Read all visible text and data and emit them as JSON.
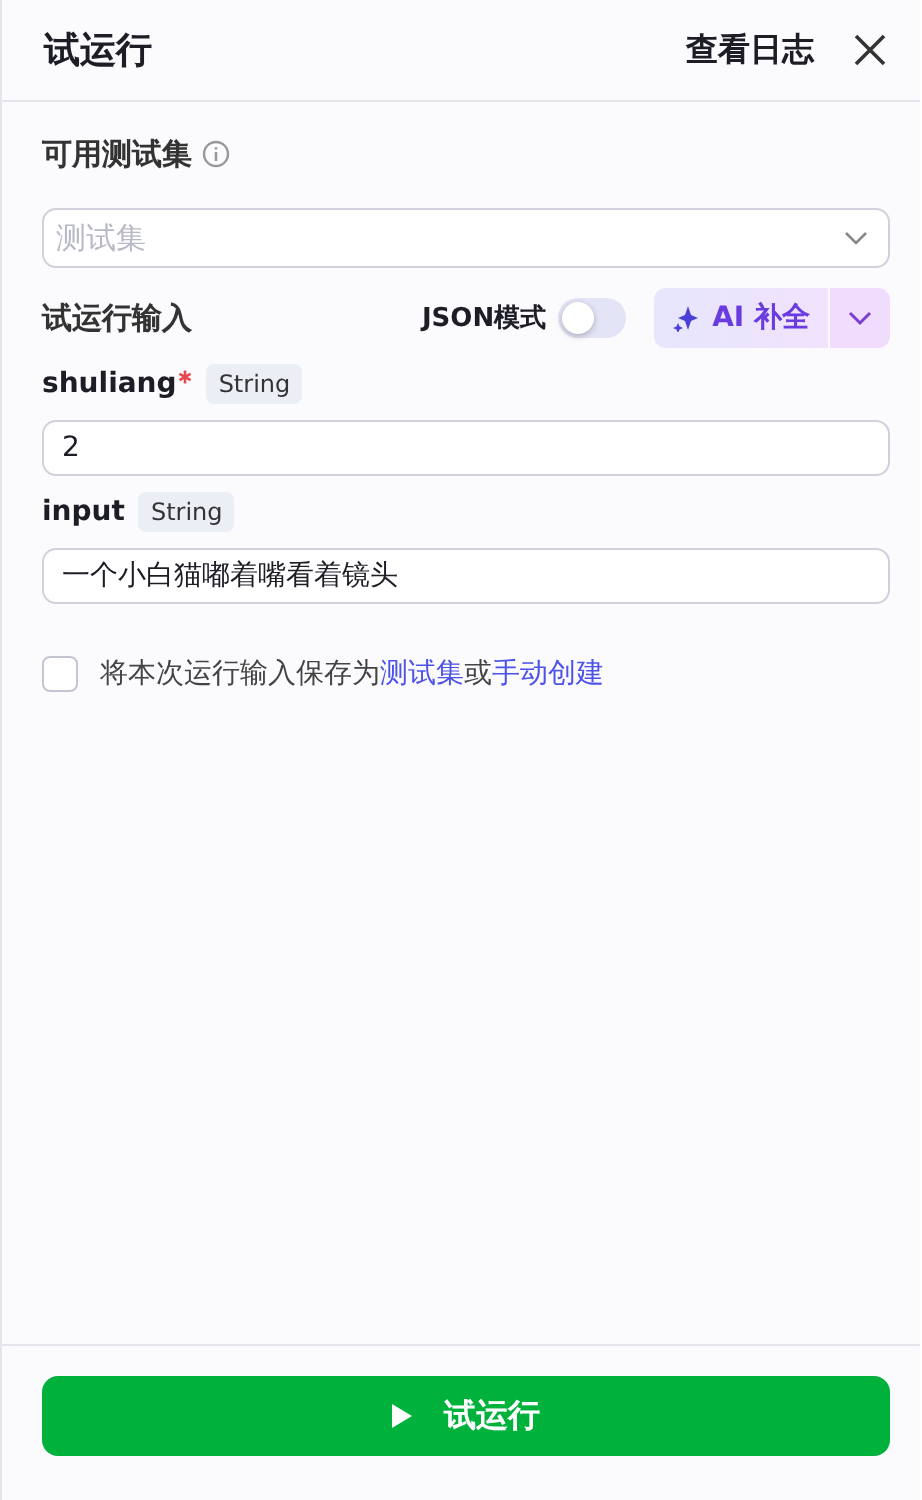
{
  "header": {
    "title": "试运行",
    "log_link": "查看日志"
  },
  "test_set": {
    "label": "可用测试集",
    "select": {
      "placeholder": "测试集"
    }
  },
  "run_input": {
    "label": "试运行输入",
    "json_mode": {
      "label": "JSON模式",
      "on": false
    },
    "ai_button": "AI 补全"
  },
  "params": [
    {
      "name": "shuliang",
      "required": true,
      "type": "String",
      "value": "2"
    },
    {
      "name": "input",
      "required": false,
      "type": "String",
      "value": "一个小白猫嘟着嘴看着镜头"
    }
  ],
  "save": {
    "checked": false,
    "parts": [
      {
        "kind": "text",
        "text": "将本次运行输入保存为"
      },
      {
        "kind": "link",
        "text": "测试集"
      },
      {
        "kind": "text",
        "text": "或"
      },
      {
        "kind": "link",
        "text": "手动创建"
      }
    ]
  },
  "run_button": "试运行"
}
